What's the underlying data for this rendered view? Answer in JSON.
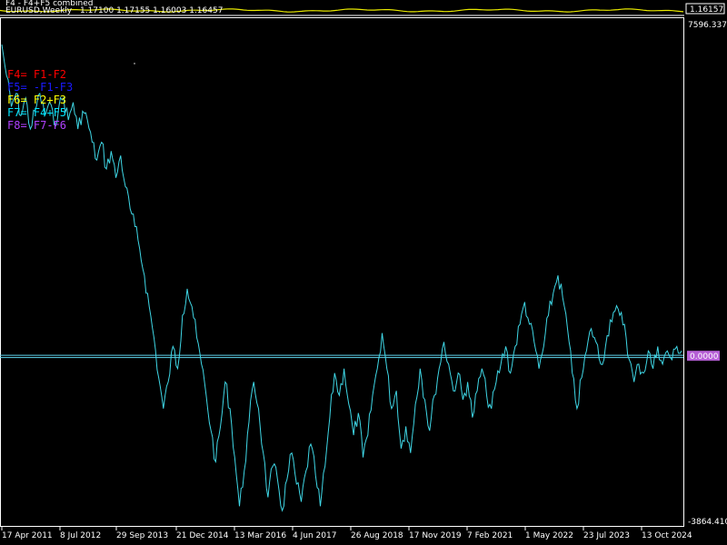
{
  "header": {
    "indicator_title": "F4 - F4+F5 combined",
    "symbol_line": "EURUSD,Weekly",
    "ohlc": "1.17100 1.17155 1.16003 1.16457",
    "top_price_label": "1.16157"
  },
  "colors": {
    "background": "#000000",
    "frame": "#ffffff",
    "series": "#3fd7e6",
    "zero_line": "#5fd7ef",
    "top_indicator": "#e8e800",
    "f4": "#ff0000",
    "f5": "#1a1aff",
    "f6": "#ffff00",
    "f7": "#00e5ff",
    "f8": "#b040ff",
    "value_badge": "#b65fd6"
  },
  "legend": [
    {
      "key": "f4",
      "text": "F4= F1-F2"
    },
    {
      "key": "f5",
      "text": "F5= -F1-F3"
    },
    {
      "key": "f6",
      "text": "F6= F2+F3"
    },
    {
      "key": "f7",
      "text": "F7= F4+F5"
    },
    {
      "key": "f8",
      "text": "F8= F7-F6"
    }
  ],
  "axis": {
    "y_top_label": "7596.3372",
    "y_bottom_label": "-3864.4107",
    "current_value_label": "0.0000",
    "x_labels": [
      "17 Apr 2011",
      "8 Jul 2012",
      "29 Sep 2013",
      "21 Dec 2014",
      "13 Mar 2016",
      "4 Jun 2017",
      "26 Aug 2018",
      "17 Nov 2019",
      "7 Feb 2021",
      "1 May 2022",
      "23 Jul 2023",
      "13 Oct 2024"
    ]
  },
  "chart_data": {
    "type": "line",
    "ylim": [
      -3864.4107,
      7596.3372
    ],
    "series": [
      {
        "values": [
          7000,
          6300,
          5600,
          5900,
          5400,
          5800,
          5100,
          5500,
          5900,
          5400,
          5700,
          5200,
          5600,
          5800,
          5300,
          5700,
          5100,
          5500,
          5300,
          4800,
          4400,
          4800,
          4200,
          4600,
          4000,
          4500,
          3800,
          3300,
          2900,
          2400,
          1800,
          1100,
          400,
          -500,
          -1200,
          -600,
          200,
          -300,
          900,
          1500,
          1100,
          400,
          -200,
          -900,
          -1700,
          -2400,
          -1600,
          -600,
          -1200,
          -2300,
          -3400,
          -2600,
          -1500,
          -600,
          -1200,
          -2200,
          -3200,
          -2500,
          -2800,
          -3500,
          -2800,
          -2200,
          -2900,
          -3300,
          -2600,
          -2000,
          -2700,
          -3400,
          -2500,
          -1400,
          -400,
          -900,
          -300,
          -1100,
          -1800,
          -1300,
          -2300,
          -1800,
          -900,
          -300,
          500,
          -300,
          -1200,
          -800,
          -2100,
          -1600,
          -2200,
          -1100,
          -300,
          -1000,
          -1700,
          -900,
          -300,
          300,
          -200,
          -800,
          -400,
          -1000,
          -600,
          -1400,
          -800,
          -300,
          -900,
          -1200,
          -600,
          -200,
          200,
          -400,
          200,
          700,
          1200,
          700,
          300,
          -300,
          200,
          900,
          1400,
          1800,
          1300,
          600,
          -400,
          -1200,
          -500,
          100,
          600,
          300,
          -200,
          200,
          800,
          1000,
          900,
          700,
          -100,
          -600,
          -200,
          -400,
          100,
          -300,
          200,
          -200,
          100,
          -100,
          200,
          100
        ]
      }
    ]
  }
}
